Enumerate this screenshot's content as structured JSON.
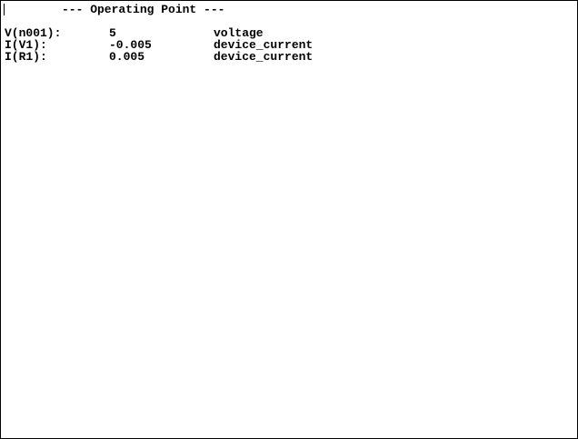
{
  "header": {
    "title": "--- Operating Point ---"
  },
  "results": [
    {
      "name": "V(n001):",
      "value": "5",
      "type": "voltage"
    },
    {
      "name": "I(V1):",
      "value": "-0.005",
      "type": "device_current"
    },
    {
      "name": "I(R1):",
      "value": "0.005",
      "type": "device_current"
    }
  ]
}
